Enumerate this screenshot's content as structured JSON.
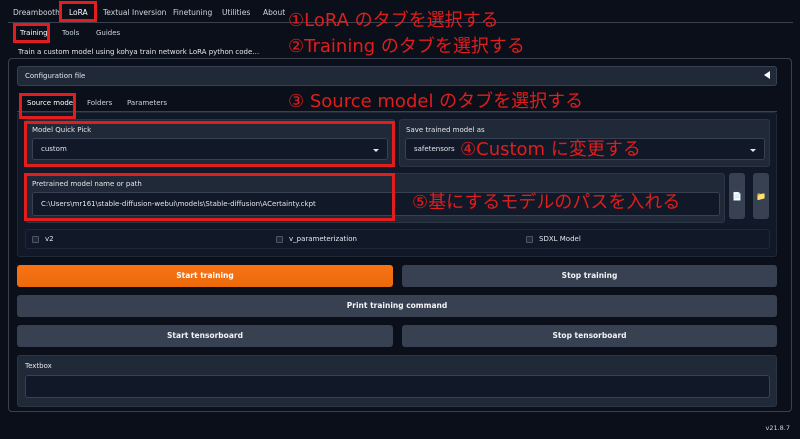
{
  "top_tabs": [
    "Dreambooth",
    "LoRA",
    "Textual Inversion",
    "Finetuning",
    "Utilities",
    "About"
  ],
  "sub_tabs": [
    "Training",
    "Tools",
    "Guides"
  ],
  "description": "Train a custom model using kohya train network LoRA python code…",
  "configuration_file_label": "Configuration file",
  "source_tabs": [
    "Source model",
    "Folders",
    "Parameters"
  ],
  "model_quick_pick": {
    "label": "Model Quick Pick",
    "value": "custom"
  },
  "save_trained_model": {
    "label": "Save trained model as",
    "value": "safetensors"
  },
  "pretrained_model": {
    "label": "Pretrained model name or path",
    "value": "C:\\Users\\mr161\\stable-diffusion-webui\\models\\Stable-diffusion\\ACertainty.ckpt"
  },
  "checkboxes": [
    "v2",
    "v_parameterization",
    "SDXL Model"
  ],
  "buttons": {
    "start_training": "Start training",
    "stop_training": "Stop training",
    "print_command": "Print training command",
    "start_tensorboard": "Start tensorboard",
    "stop_tensorboard": "Stop tensorboard"
  },
  "textbox_label": "Textbox",
  "version": "v21.8.7",
  "annotations": {
    "a1": "①LoRA のタブを選択する",
    "a2": "②Training のタブを選択する",
    "a3": "③ Source model のタブを選択する",
    "a4": "④Custom に変更する",
    "a5": "⑤基にするモデルのパスを入れる"
  },
  "colors": {
    "accent_orange": "#f97316",
    "annotation_red": "#e11d1d",
    "background": "#0b0f19"
  },
  "icons": [
    "triangle-left-icon",
    "caret-down-icon",
    "file-icon",
    "folder-icon"
  ]
}
